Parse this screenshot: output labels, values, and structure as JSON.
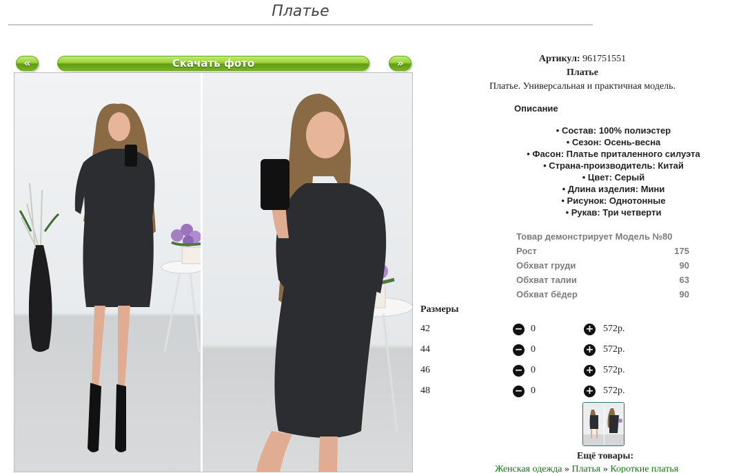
{
  "page": {
    "title": "Платье"
  },
  "gallery": {
    "prev_label": "«",
    "download_label": "Скачать фото",
    "next_label": "»"
  },
  "product": {
    "article_label": "Артикул:",
    "article_value": "961751551",
    "name": "Платье",
    "tagline": "Платье. Универсальная и практичная модель."
  },
  "description": {
    "heading": "Описание",
    "features": [
      "• Состав: 100% полиэстер",
      "• Сезон: Осень-весна",
      "• Фасон: Платье приталенного силуэта",
      "• Страна-производитель: Китай",
      "• Цвет: Серый",
      "• Длина изделия: Мини",
      "• Рисунок: Однотонные",
      "• Рукав: Три четверти"
    ]
  },
  "measurements": [
    {
      "label": "Товар демонстрирует Модель №80",
      "value": ""
    },
    {
      "label": "Рост",
      "value": "175"
    },
    {
      "label": "Обхват груди",
      "value": "90"
    },
    {
      "label": "Обхват талии",
      "value": "63"
    },
    {
      "label": "Обхват бёдер",
      "value": "90"
    }
  ],
  "sizes": {
    "heading": "Размеры",
    "minus_glyph": "−",
    "plus_glyph": "+",
    "rows": [
      {
        "size": "42",
        "qty": "0",
        "price": "572р."
      },
      {
        "size": "44",
        "qty": "0",
        "price": "572р."
      },
      {
        "size": "46",
        "qty": "0",
        "price": "572р."
      },
      {
        "size": "48",
        "qty": "0",
        "price": "572р."
      }
    ]
  },
  "more": {
    "heading": "Ещё товары:",
    "breadcrumb": [
      "Женская одежда",
      "Платья",
      "Короткие платья"
    ],
    "separator": " » "
  },
  "colors": {
    "button_green": "#78b526",
    "link_green": "#117a11",
    "dress": "#2b2d31",
    "hair": "#8a6a44"
  }
}
